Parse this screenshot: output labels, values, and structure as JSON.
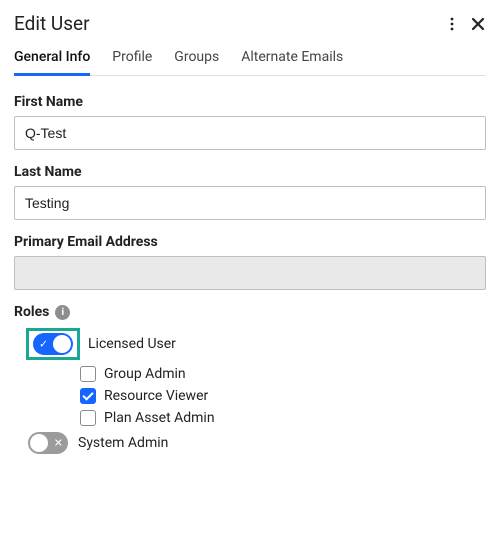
{
  "header": {
    "title": "Edit User"
  },
  "tabs": {
    "items": [
      {
        "label": "General Info",
        "active": true
      },
      {
        "label": "Profile",
        "active": false
      },
      {
        "label": "Groups",
        "active": false
      },
      {
        "label": "Alternate Emails",
        "active": false
      }
    ]
  },
  "fields": {
    "first_name": {
      "label": "First Name",
      "value": "Q-Test"
    },
    "last_name": {
      "label": "Last Name",
      "value": "Testing"
    },
    "primary_email": {
      "label": "Primary Email Address",
      "value": ""
    }
  },
  "roles": {
    "label": "Roles",
    "licensed_user": {
      "label": "Licensed User",
      "on": true,
      "highlighted": true
    },
    "group_admin": {
      "label": "Group Admin",
      "checked": false
    },
    "resource_viewer": {
      "label": "Resource Viewer",
      "checked": true
    },
    "plan_asset_admin": {
      "label": "Plan Asset Admin",
      "checked": false
    },
    "system_admin": {
      "label": "System Admin",
      "on": false
    }
  }
}
